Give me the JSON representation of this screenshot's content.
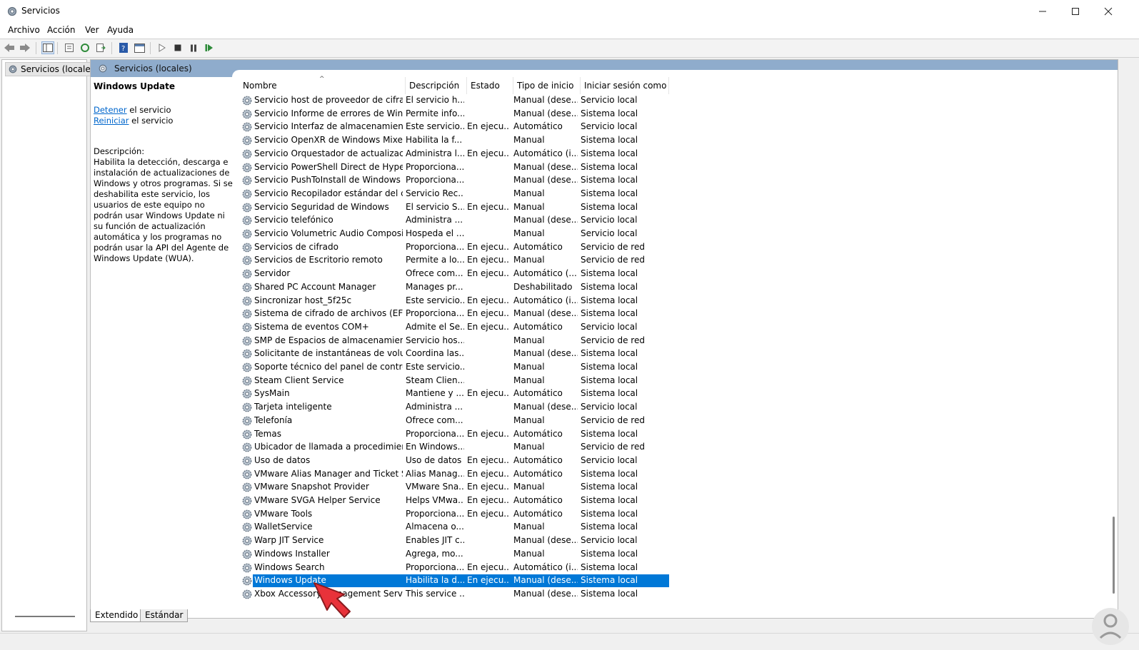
{
  "window": {
    "title": "Servicios"
  },
  "menu": [
    "Archivo",
    "Acción",
    "Ver",
    "Ayuda"
  ],
  "tree": {
    "item": "Servicios (locales)"
  },
  "pane": {
    "header": "Servicios (locales)"
  },
  "selected_service": {
    "name": "Windows Update",
    "stop_link": "Detener",
    "stop_rest": " el servicio",
    "restart_link": "Reiniciar",
    "restart_rest": " el servicio",
    "desc_label": "Descripción:",
    "description": "Habilita la detección, descarga e instalación de actualizaciones de Windows y otros programas. Si se deshabilita este servicio, los usuarios de este equipo no podrán usar Windows Update ni su función de actualización automática y los programas no podrán usar la API del Agente de Windows Update (WUA)."
  },
  "columns": [
    "Nombre",
    "Descripción",
    "Estado",
    "Tipo de inicio",
    "Iniciar sesión como"
  ],
  "rows": [
    [
      "Servicio host de proveedor de cifrado ...",
      "El servicio h...",
      "",
      "Manual (dese...",
      "Servicio local"
    ],
    [
      "Servicio Informe de errores de Windows",
      "Permite info...",
      "",
      "Manual (dese...",
      "Sistema local"
    ],
    [
      "Servicio Interfaz de almacenamiento e...",
      "Este servicio...",
      "En ejecu...",
      "Automático",
      "Servicio local"
    ],
    [
      "Servicio OpenXR de Windows Mixed R...",
      "Habilita la f...",
      "",
      "Manual",
      "Sistema local"
    ],
    [
      "Servicio Orquestador de actualizaciones",
      "Administra l...",
      "En ejecu...",
      "Automático (i...",
      "Sistema local"
    ],
    [
      "Servicio PowerShell Direct de Hyper-V",
      "Proporciona...",
      "",
      "Manual (dese...",
      "Sistema local"
    ],
    [
      "Servicio PushToInstall de Windows",
      "Proporciona...",
      "",
      "Manual (dese...",
      "Sistema local"
    ],
    [
      "Servicio Recopilador estándar del conc...",
      "Servicio Rec...",
      "",
      "Manual",
      "Sistema local"
    ],
    [
      "Servicio Seguridad de Windows",
      "El servicio S...",
      "En ejecu...",
      "Manual",
      "Sistema local"
    ],
    [
      "Servicio telefónico",
      "Administra ...",
      "",
      "Manual (dese...",
      "Servicio local"
    ],
    [
      "Servicio Volumetric Audio Compositor",
      "Hospeda el ...",
      "",
      "Manual",
      "Servicio local"
    ],
    [
      "Servicios de cifrado",
      "Proporciona...",
      "En ejecu...",
      "Automático",
      "Servicio de red"
    ],
    [
      "Servicios de Escritorio remoto",
      "Permite a lo...",
      "En ejecu...",
      "Manual",
      "Servicio de red"
    ],
    [
      "Servidor",
      "Ofrece com...",
      "En ejecu...",
      "Automático (...",
      "Sistema local"
    ],
    [
      "Shared PC Account Manager",
      "Manages pr...",
      "",
      "Deshabilitado",
      "Sistema local"
    ],
    [
      "Sincronizar host_5f25c",
      "Este servicio...",
      "En ejecu...",
      "Automático (i...",
      "Sistema local"
    ],
    [
      "Sistema de cifrado de archivos (EFS)",
      "Proporciona...",
      "En ejecu...",
      "Manual (dese...",
      "Sistema local"
    ],
    [
      "Sistema de eventos COM+",
      "Admite el Se...",
      "En ejecu...",
      "Automático",
      "Servicio local"
    ],
    [
      "SMP de Espacios de almacenamiento ...",
      "Servicio hos...",
      "",
      "Manual",
      "Servicio de red"
    ],
    [
      "Solicitante de instantáneas de volume...",
      "Coordina las...",
      "",
      "Manual (dese...",
      "Sistema local"
    ],
    [
      "Soporte técnico del panel de control In...",
      "Este servicio...",
      "",
      "Manual",
      "Sistema local"
    ],
    [
      "Steam Client Service",
      "Steam Clien...",
      "",
      "Manual",
      "Sistema local"
    ],
    [
      "SysMain",
      "Mantiene y ...",
      "En ejecu...",
      "Automático",
      "Sistema local"
    ],
    [
      "Tarjeta inteligente",
      "Administra ...",
      "",
      "Manual (dese...",
      "Servicio local"
    ],
    [
      "Telefonía",
      "Ofrece com...",
      "",
      "Manual",
      "Servicio de red"
    ],
    [
      "Temas",
      "Proporciona...",
      "En ejecu...",
      "Automático",
      "Sistema local"
    ],
    [
      "Ubicador de llamada a procedimiento ...",
      "En Windows...",
      "",
      "Manual",
      "Servicio de red"
    ],
    [
      "Uso de datos",
      "Uso de datos",
      "En ejecu...",
      "Automático",
      "Servicio local"
    ],
    [
      "VMware Alias Manager and Ticket Serv...",
      "Alias Manag...",
      "En ejecu...",
      "Automático",
      "Sistema local"
    ],
    [
      "VMware Snapshot Provider",
      "VMware Sna...",
      "En ejecu...",
      "Manual",
      "Sistema local"
    ],
    [
      "VMware SVGA Helper Service",
      "Helps VMwa...",
      "En ejecu...",
      "Automático",
      "Sistema local"
    ],
    [
      "VMware Tools",
      "Proporciona...",
      "En ejecu...",
      "Automático",
      "Sistema local"
    ],
    [
      "WalletService",
      "Almacena o...",
      "",
      "Manual",
      "Sistema local"
    ],
    [
      "Warp JIT Service",
      "Enables JIT c...",
      "",
      "Manual (dese...",
      "Servicio local"
    ],
    [
      "Windows Installer",
      "Agrega, mo...",
      "",
      "Manual",
      "Sistema local"
    ],
    [
      "Windows Search",
      "Proporciona...",
      "En ejecu...",
      "Automático (i...",
      "Sistema local"
    ],
    [
      "Windows Update",
      "Habilita la d...",
      "En ejecu...",
      "Manual (dese...",
      "Sistema local"
    ],
    [
      "Xbox Accessory Management Service",
      "This service ...",
      "",
      "Manual (dese...",
      "Sistema local"
    ]
  ],
  "selected_row_index": 36,
  "tabs": [
    "Extendido",
    "Estándar"
  ],
  "colors": {
    "selection": "#0078d7",
    "pane_header": "#8faccc",
    "link": "#0066cc",
    "cursor": "#e8323a"
  }
}
